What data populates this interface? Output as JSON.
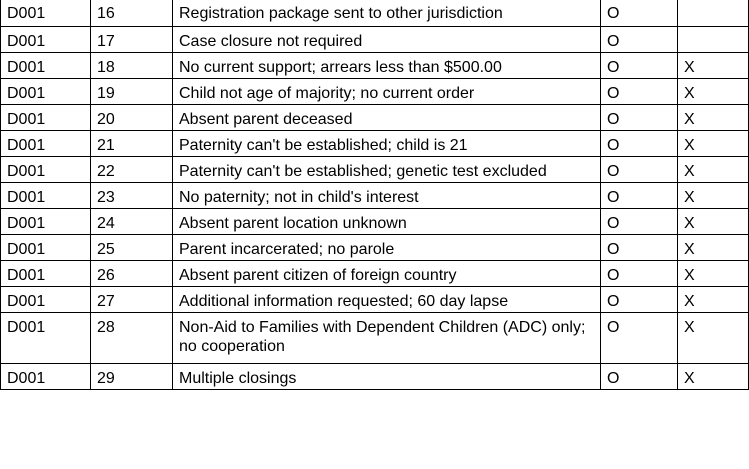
{
  "rows": [
    {
      "code": "D001",
      "num": "16",
      "desc": "Registration package sent to other jurisdiction",
      "o": "O",
      "x": ""
    },
    {
      "code": "D001",
      "num": "17",
      "desc": "Case closure not required",
      "o": "O",
      "x": ""
    },
    {
      "code": "D001",
      "num": "18",
      "desc": "No current support; arrears less than $500.00",
      "o": "O",
      "x": "X"
    },
    {
      "code": "D001",
      "num": "19",
      "desc": "Child not age of majority; no current order",
      "o": "O",
      "x": "X"
    },
    {
      "code": "D001",
      "num": "20",
      "desc": "Absent parent deceased",
      "o": "O",
      "x": "X"
    },
    {
      "code": "D001",
      "num": "21",
      "desc": "Paternity can't be established; child is 21",
      "o": "O",
      "x": "X"
    },
    {
      "code": "D001",
      "num": "22",
      "desc": "Paternity can't be established; genetic test excluded",
      "o": "O",
      "x": "X"
    },
    {
      "code": "D001",
      "num": "23",
      "desc": "No paternity; not in child's interest",
      "o": "O",
      "x": "X"
    },
    {
      "code": "D001",
      "num": "24",
      "desc": "Absent parent location unknown",
      "o": "O",
      "x": "X"
    },
    {
      "code": "D001",
      "num": "25",
      "desc": "Parent incarcerated; no parole",
      "o": "O",
      "x": "X"
    },
    {
      "code": "D001",
      "num": "26",
      "desc": "Absent parent citizen of foreign country",
      "o": "O",
      "x": "X"
    },
    {
      "code": "D001",
      "num": "27",
      "desc": "Additional information requested; 60 day lapse",
      "o": "O",
      "x": "X"
    },
    {
      "code": "D001",
      "num": "28",
      "desc": "Non-Aid to Families with Dependent Children (ADC) only; no cooperation",
      "o": "O",
      "x": "X"
    },
    {
      "code": "D001",
      "num": "29",
      "desc": "Multiple closings",
      "o": "O",
      "x": "X"
    }
  ]
}
